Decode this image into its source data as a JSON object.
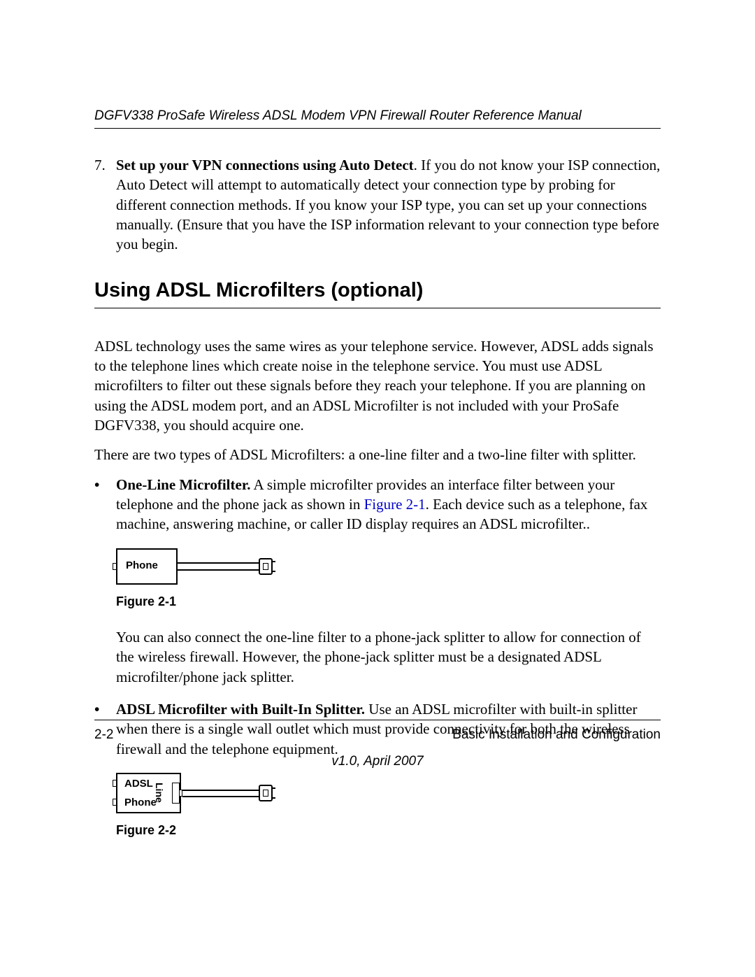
{
  "header": {
    "manual_title": "DGFV338 ProSafe Wireless ADSL Modem VPN Firewall Router Reference Manual"
  },
  "step7": {
    "number": "7.",
    "bold": "Set up your VPN connections using Auto Detect",
    "rest": ". If you do not know your ISP connection, Auto Detect will attempt to automatically detect your connection type by probing for different connection methods. If you know your ISP type, you can set up your connections manually. (Ensure that you have the ISP information relevant to your connection type before you begin."
  },
  "section": {
    "heading": "Using ADSL Microfilters (optional)"
  },
  "p1": "ADSL technology uses the same wires as your telephone service. However, ADSL adds signals to the telephone lines which create noise in the telephone service. You must use ADSL microfilters to filter out these signals before they reach your telephone. If you are planning on using the ADSL modem port, and an ADSL Microfilter is not included with your ProSafe DGFV338, you should acquire one.",
  "p2": "There are two types of ADSL Microfilters: a one-line filter and a two-line filter with splitter.",
  "bullet1": {
    "bold": "One-Line Microfilter.",
    "text_before_link": " A simple microfilter provides an interface filter between your telephone and the phone jack as shown in ",
    "link": "Figure 2-1",
    "text_after_link": ". Each device such as a telephone, fax machine, answering machine, or caller ID display requires an ADSL microfilter.."
  },
  "figure1": {
    "label_phone": "Phone",
    "caption": "Figure 2-1"
  },
  "sub1": "You can also connect the one-line filter to a phone-jack splitter to allow for connection of the wireless firewall. However, the phone-jack splitter must be a designated ADSL microfilter/phone jack splitter.",
  "bullet2": {
    "bold": "ADSL Microfilter with Built-In Splitter.",
    "rest": " Use an ADSL microfilter with built-in splitter when there is a single wall outlet which must provide connectivity for both the wireless firewall and the telephone equipment."
  },
  "figure2": {
    "label_adsl": "ADSL",
    "label_phone": "Phone",
    "label_line": "Line",
    "caption": "Figure 2-2"
  },
  "footer": {
    "page_num": "2-2",
    "chapter": "Basic Installation and Configuration",
    "version": "v1.0, April 2007"
  }
}
